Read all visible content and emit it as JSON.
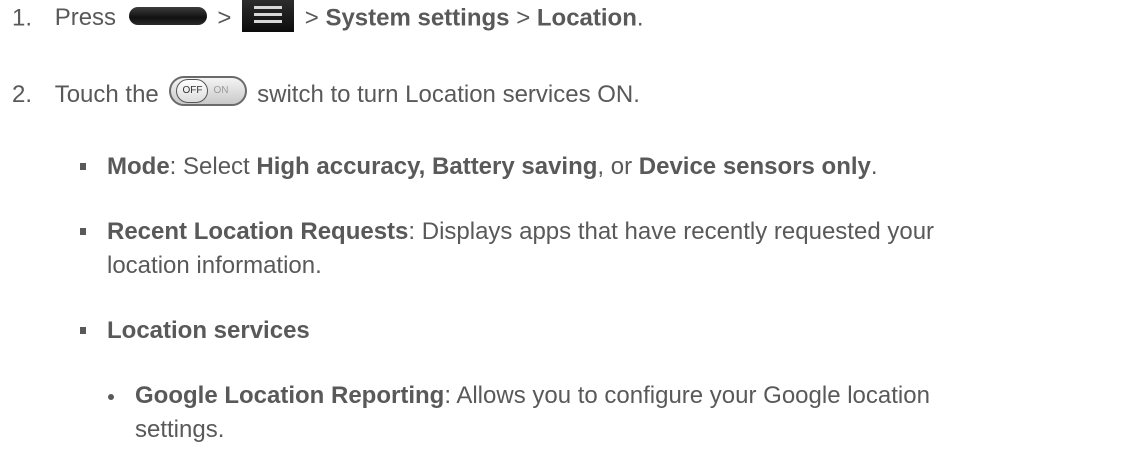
{
  "steps": [
    {
      "number": "1.",
      "press": "Press",
      "sep1": ">",
      "sep2": ">",
      "system_settings": "System settings",
      "sep3": ">",
      "location": "Location",
      "period": ".",
      "home_key_icon": "home-key-icon",
      "menu_key_icon": "menu-key-icon"
    },
    {
      "number": "2.",
      "touch_the": "Touch the",
      "toggle_off": "OFF",
      "toggle_on": "ON",
      "rest": "switch to turn Location services ON."
    }
  ],
  "options": [
    {
      "term": "Mode",
      "colon": ": Select ",
      "opt1": "High accuracy, Battery saving",
      "or": ", or ",
      "opt2": "Device sensors only",
      "period": "."
    },
    {
      "term": "Recent Location Requests",
      "desc_line1": ": Displays apps that have recently requested your",
      "desc_line2": "location information."
    },
    {
      "term": "Location services"
    }
  ],
  "sub_options": [
    {
      "term": "Google Location Reporting",
      "desc_line1": ": Allows you to configure your Google location",
      "desc_line2": "settings."
    }
  ],
  "colors": {
    "text": "#595959"
  }
}
